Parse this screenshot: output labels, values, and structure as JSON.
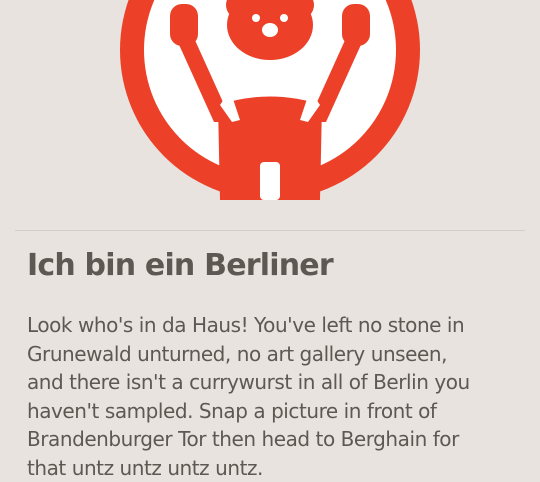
{
  "badge": {
    "icon": "berlin-bear-icon",
    "accent_color": "#ec4028",
    "inner_color": "#ffffff"
  },
  "achievement": {
    "title": "Ich bin ein Berliner",
    "description_lines": [
      "Look who's in da Haus! You've left no stone in",
      "Grunewald unturned, no art gallery unseen,",
      "and there isn't a currywurst in all of Berlin you",
      "haven't sampled. Snap a picture in front of",
      "Brandenburger Tor then head to Berghain for",
      "that untz untz untz untz."
    ]
  }
}
